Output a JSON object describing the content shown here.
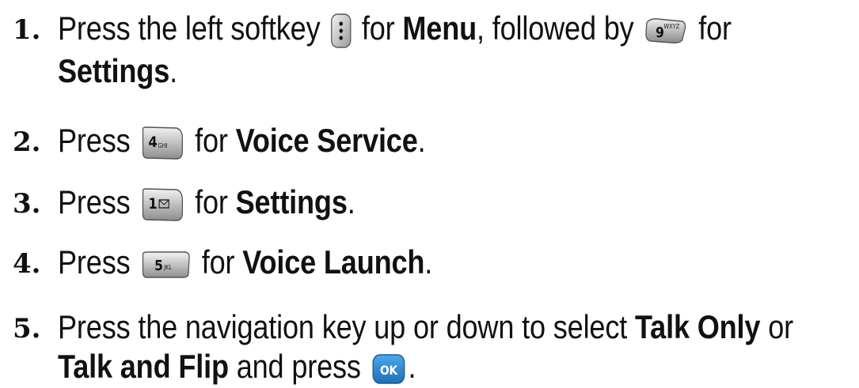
{
  "steps": [
    {
      "number": "1.",
      "line1": {
        "t1": "Press the left softkey ",
        "t2": " for ",
        "b1": "Menu",
        "t3": ", followed by ",
        "t4": " for"
      },
      "line2": {
        "b1": "Settings",
        "t1": "."
      },
      "keys": [
        {
          "icon": "left-softkey-icon",
          "label": ""
        },
        {
          "icon": "key-9-wxyz-icon",
          "label": "9",
          "sub": "WXYZ"
        }
      ]
    },
    {
      "number": "2.",
      "t1": "Press ",
      "t2": " for ",
      "b1": "Voice Service",
      "t3": ".",
      "key": {
        "icon": "key-4-ghi-icon",
        "label": "4",
        "sub": "GHI"
      }
    },
    {
      "number": "3.",
      "t1": "Press ",
      "t2": " for ",
      "b1": "Settings",
      "t3": ".",
      "key": {
        "icon": "key-1-voicemail-icon",
        "label": "1",
        "sub": ""
      }
    },
    {
      "number": "4.",
      "t1": "Press ",
      "t2": " for ",
      "b1": "Voice Launch",
      "t3": ".",
      "key": {
        "icon": "key-5-jkl-icon",
        "label": "5",
        "sub": "JKL"
      }
    },
    {
      "number": "5.",
      "line1": {
        "t1": "Press the navigation key up or down to select ",
        "b1": "Talk Only",
        "t2": " or"
      },
      "line2": {
        "b1": "Talk and Flip",
        "t1": " and press ",
        "t2": "."
      },
      "key": {
        "icon": "ok-key-icon",
        "label": "OK"
      }
    }
  ],
  "colors": {
    "text": "#111111",
    "ok_key": "#2f8fd6"
  }
}
